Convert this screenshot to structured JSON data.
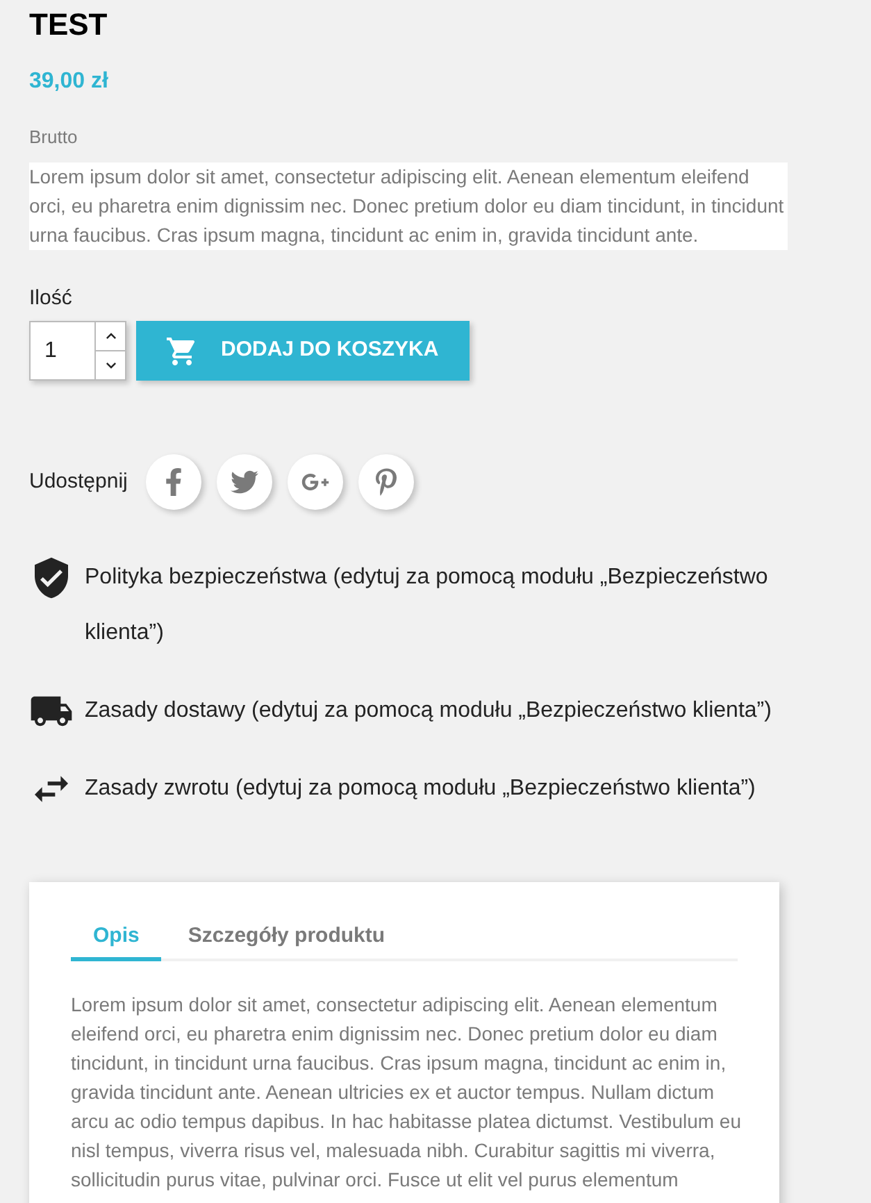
{
  "product": {
    "title": "TEST",
    "price": "39,00 zł",
    "tax_label": "Brutto",
    "short_description": "Lorem ipsum dolor sit amet, consectetur adipiscing elit. Aenean elementum eleifend orci, eu pharetra enim dignissim nec. Donec pretium dolor eu diam tincidunt, in tincidunt urna faucibus. Cras ipsum magna, tincidunt ac enim in, gravida tincidunt ante."
  },
  "quantity": {
    "label": "Ilość",
    "value": "1"
  },
  "add_to_cart": {
    "label": "DODAJ DO KOSZYKA"
  },
  "share": {
    "label": "Udostępnij"
  },
  "reassurance": [
    {
      "text": "Polityka bezpieczeństwa (edytuj za pomocą modułu „Bezpieczeństwo klienta”)"
    },
    {
      "text": "Zasady dostawy (edytuj za pomocą modułu „Bezpieczeństwo klienta”)"
    },
    {
      "text": "Zasady zwrotu (edytuj za pomocą modułu „Bezpieczeństwo klienta”)"
    }
  ],
  "tabs": [
    {
      "label": "Opis",
      "selected": true
    },
    {
      "label": "Szczegóły produktu",
      "selected": false
    }
  ],
  "description": "Lorem ipsum dolor sit amet, consectetur adipiscing elit. Aenean elementum eleifend orci, eu pharetra enim dignissim nec. Donec pretium dolor eu diam tincidunt, in tincidunt urna faucibus. Cras ipsum magna, tincidunt ac enim in, gravida tincidunt ante. Aenean ultricies ex et auctor tempus. Nullam dictum arcu ac odio tempus dapibus. In hac habitasse platea dictumst. Vestibulum eu nisl tempus, viverra risus vel, malesuada nibh. Curabitur sagittis mi viverra, sollicitudin purus vitae, pulvinar orci. Fusce ut elit vel purus elementum"
}
